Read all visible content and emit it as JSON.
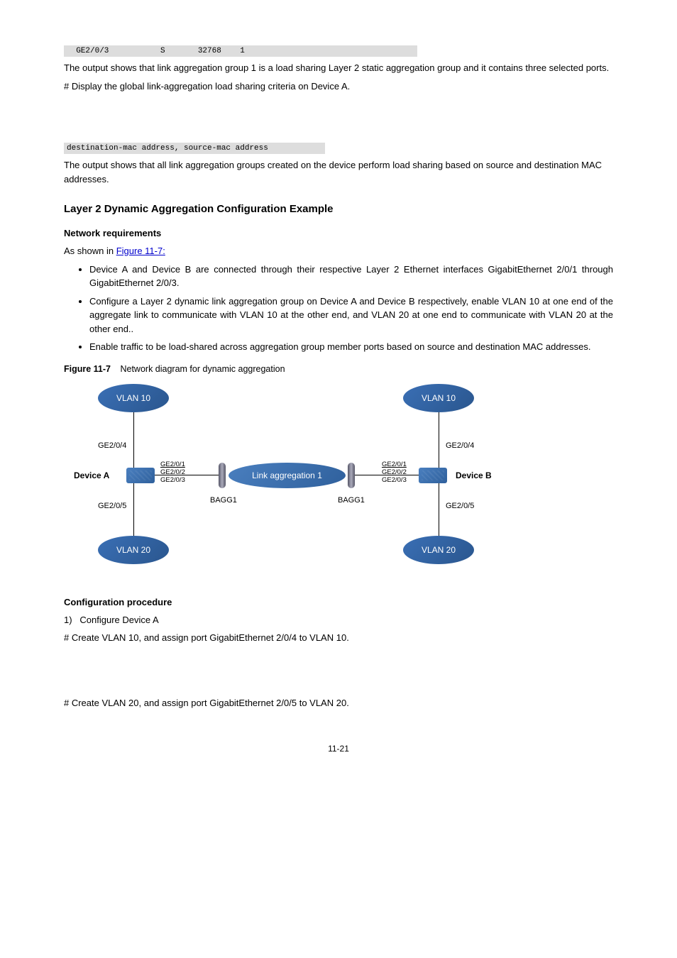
{
  "gray1": "  GE2/0/3           S       32768    1                                     ",
  "p1": "The output shows that link aggregation group 1 is a load sharing Layer 2 static aggregation group and it contains three selected ports.",
  "p2": "# Display the global link-aggregation load sharing criteria on Device A.",
  "gray2": "destination-mac address, source-mac address           ",
  "p3": "The output shows that all link aggregation groups created on the device perform load sharing based on source and destination MAC addresses.",
  "sec_title": "Layer 2 Dynamic Aggregation Configuration Example",
  "sub_netreq": "Network requirements",
  "asshown_prefix": "As shown in ",
  "asshown_link": "Figure 11-7: ",
  "bullets": [
    "Device A and Device B are connected through their respective Layer 2 Ethernet interfaces GigabitEthernet 2/0/1 through GigabitEthernet 2/0/3.",
    "Configure a Layer 2 dynamic link aggregation group on Device A and Device B respectively, enable VLAN 10 at one end of the aggregate link to communicate with VLAN 10 at the other end, and VLAN 20 at one end to communicate with VLAN 20 at the other end..",
    "Enable traffic to be load-shared across aggregation group member ports based on source and destination MAC addresses."
  ],
  "fig_prefix": "Figure 11-7",
  "fig_caption": "Network diagram for dynamic aggregation",
  "diagram": {
    "vlan10": "VLAN 10",
    "vlan20": "VLAN 20",
    "linkagg": "Link aggregation 1",
    "devA": "Device A",
    "devB": "Device B",
    "ge204": "GE2/0/4",
    "ge205": "GE2/0/5",
    "ge201": "GE2/0/1",
    "ge202": "GE2/0/2",
    "ge203": "GE2/0/3",
    "bagg": "BAGG1"
  },
  "sub_cfg": "Configuration procedure",
  "cfg1_num": "1)",
  "cfg1_text": "Configure Device A",
  "cfg_line1": "# Create VLAN 10, and assign port GigabitEthernet 2/0/4 to VLAN 10.",
  "cfg_line2": "# Create VLAN 20, and assign port GigabitEthernet 2/0/5 to VLAN 20.",
  "pagenum": "11-21"
}
